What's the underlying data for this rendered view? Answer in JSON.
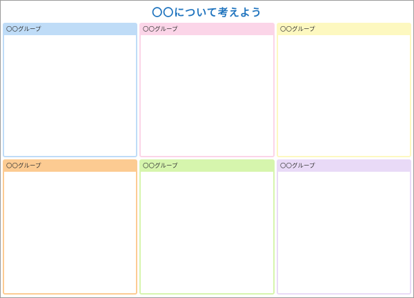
{
  "title": "〇〇について考えよう",
  "panels": [
    {
      "label": "〇〇グループ",
      "header_color": "#bfdcf7",
      "border_color": "#bfdcf7"
    },
    {
      "label": "〇〇グループ",
      "header_color": "#fbd5e8",
      "border_color": "#fbd5e8"
    },
    {
      "label": "〇〇グループ",
      "header_color": "#fdf8c0",
      "border_color": "#fdf8c0"
    },
    {
      "label": "〇〇グループ",
      "header_color": "#fccb92",
      "border_color": "#fccb92"
    },
    {
      "label": "〇〇グループ",
      "header_color": "#d6f5ad",
      "border_color": "#d6f5ad"
    },
    {
      "label": "〇〇グループ",
      "header_color": "#e9daf7",
      "border_color": "#e9daf7"
    }
  ]
}
